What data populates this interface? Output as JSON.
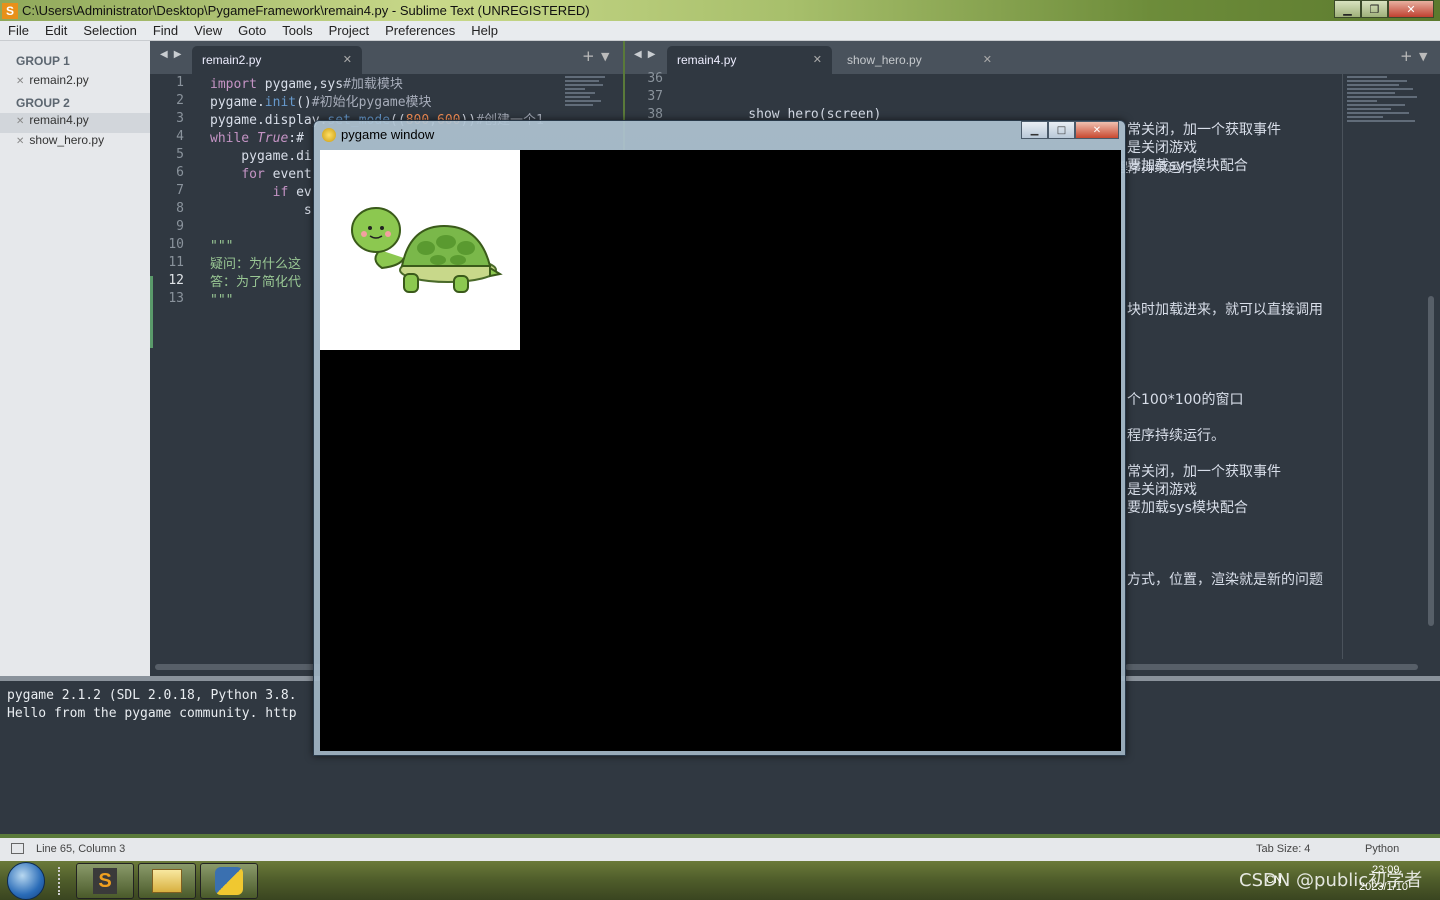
{
  "window": {
    "title": "C:\\Users\\Administrator\\Desktop\\PygameFramework\\remain4.py - Sublime Text (UNREGISTERED)",
    "app_icon": "S",
    "controls": {
      "min": "▁",
      "max": "❐",
      "close": "✕"
    }
  },
  "menu": [
    "File",
    "Edit",
    "Selection",
    "Find",
    "View",
    "Goto",
    "Tools",
    "Project",
    "Preferences",
    "Help"
  ],
  "sidebar": {
    "group1": "GROUP 1",
    "group1_files": [
      "remain2.py"
    ],
    "group2": "GROUP 2",
    "group2_files": [
      "remain4.py",
      "show_hero.py"
    ]
  },
  "left_pane": {
    "tabs": [
      {
        "label": "remain2.py",
        "active": true
      }
    ],
    "line_numbers": [
      "1",
      "2",
      "3",
      "4",
      "5",
      "6",
      "7",
      "8",
      "9",
      "10",
      "11",
      "12",
      "13"
    ],
    "current_line": "12",
    "code": [
      [
        {
          "t": "import",
          "c": "kw"
        },
        {
          "t": " pygame,sys"
        },
        {
          "t": "#加载模块",
          "c": "cm"
        }
      ],
      [
        {
          "t": "pygame."
        },
        {
          "t": "init",
          "c": "fn"
        },
        {
          "t": "()"
        },
        {
          "t": "#初始化pygame模块",
          "c": "cm"
        }
      ],
      [
        {
          "t": "pygame.display."
        },
        {
          "t": "set_mode",
          "c": "fn"
        },
        {
          "t": "(("
        },
        {
          "t": "800",
          "c": "nm"
        },
        {
          "t": ","
        },
        {
          "t": "600",
          "c": "nm"
        },
        {
          "t": "))"
        },
        {
          "t": "#创建一个1",
          "c": "cm"
        }
      ],
      [
        {
          "t": "while",
          "c": "kw"
        },
        {
          "t": " "
        },
        {
          "t": "True",
          "c": "it"
        },
        {
          "t": ":#"
        }
      ],
      [
        {
          "t": "    pygame.di"
        }
      ],
      [
        {
          "t": "    "
        },
        {
          "t": "for",
          "c": "kw"
        },
        {
          "t": " event"
        }
      ],
      [
        {
          "t": "        "
        },
        {
          "t": "if",
          "c": "kw"
        },
        {
          "t": " ev"
        }
      ],
      [
        {
          "t": "            s"
        }
      ],
      [
        {
          "t": ""
        }
      ],
      [
        {
          "t": "\"\"\"",
          "c": "st"
        }
      ],
      [
        {
          "t": "疑问：为什么这",
          "c": "st"
        }
      ],
      [
        {
          "t": "答：为了简化代",
          "c": "st"
        }
      ],
      [
        {
          "t": "\"\"\"",
          "c": "st"
        }
      ]
    ]
  },
  "right_pane": {
    "tabs": [
      {
        "label": "remain4.py",
        "active": true
      },
      {
        "label": "show_hero.py",
        "active": false
      }
    ],
    "line_numbers": [
      "36",
      "37",
      "38"
    ],
    "code": [
      "    show_hero(screen)",
      "    while True:#因为窗口一闪就消失了，需要一个无限循环，让程序持续运行。",
      "        pygame.display.update()#刷新屏幕"
    ],
    "visible_tail_text": [
      "常关闭，加一个获取事件",
      "是关闭游戏",
      "要加载sys模块配合",
      "块时加载进来，就可以直接调用",
      "个100*100的窗口",
      "程序持续运行。",
      "常关闭，加一个获取事件",
      "是关闭游戏",
      "要加载sys模块配合",
      "方式，位置，渲染就是新的问题"
    ]
  },
  "console": {
    "lines": [
      "pygame 2.1.2 (SDL 2.0.18, Python 3.8.",
      "Hello from the pygame community. http"
    ]
  },
  "statusbar": {
    "position": "Line 65, Column 3",
    "tab_size": "Tab Size: 4",
    "syntax": "Python"
  },
  "pygame_window": {
    "title": "pygame window",
    "controls": {
      "min": "▁",
      "max": "□",
      "close": "✕"
    }
  },
  "taskbar": {
    "clock_time": "23:09",
    "clock_date": "2023/1/10",
    "tray_lang": "CN",
    "watermark": "CSDN @public初学者"
  },
  "colors": {
    "editor_bg": "#303841",
    "sidebar_bg": "#e6e8eb",
    "tab_strip": "#49525c",
    "keyword": "#c594c5",
    "function": "#6699cc",
    "comment": "#a7adba",
    "number": "#f99157",
    "string": "#99c794"
  }
}
